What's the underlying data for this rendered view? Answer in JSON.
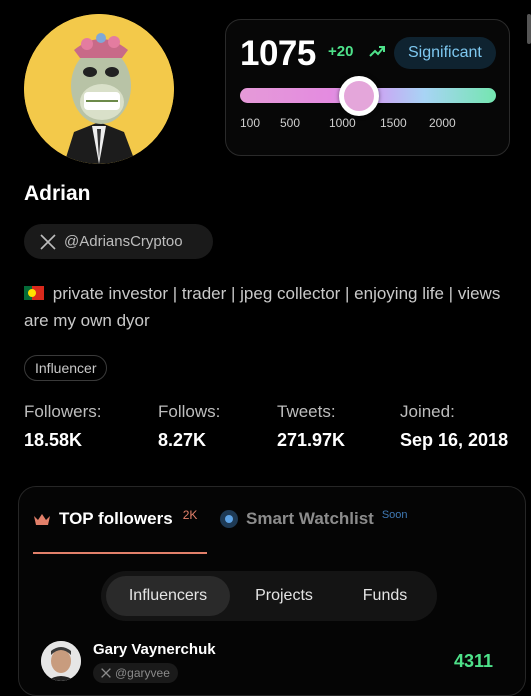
{
  "profile": {
    "name": "Adrian",
    "handle": "@AdriansCryptoo",
    "bio": "private investor | trader | jpeg collector | enjoying life | views are my own dyor",
    "tag": "Influencer"
  },
  "score": {
    "value": "1075",
    "delta": "+20",
    "badge": "Significant",
    "ticks": [
      "100",
      "500",
      "1000",
      "1500",
      "2000"
    ],
    "level": 1075,
    "colors": {
      "delta": "#4ee28a",
      "badge_text": "#7ec8f0"
    }
  },
  "stats": [
    {
      "label": "Followers:",
      "value": "18.58K"
    },
    {
      "label": "Follows:",
      "value": "8.27K"
    },
    {
      "label": "Tweets:",
      "value": "271.97K"
    },
    {
      "label": "Joined:",
      "value": "Sep 16, 2018"
    }
  ],
  "panel": {
    "tab_top": {
      "label": "TOP followers",
      "count": "2K"
    },
    "tab_watch": {
      "label": "Smart Watchlist",
      "badge": "Soon"
    },
    "segments": [
      "Influencers",
      "Projects",
      "Funds"
    ],
    "active_segment": "Influencers",
    "rows": [
      {
        "name": "Gary Vaynerchuk",
        "handle": "@garyvee",
        "score": "4311"
      }
    ]
  },
  "icons": {
    "trend": "trend-up-icon",
    "x": "x-logo-icon",
    "crown": "crown-icon",
    "watch": "target-icon"
  }
}
